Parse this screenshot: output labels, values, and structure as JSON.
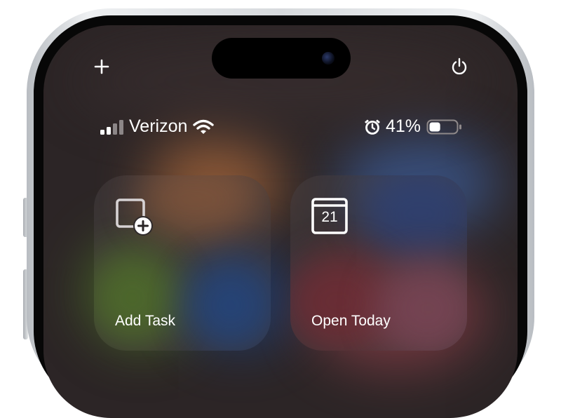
{
  "corner_actions": {
    "add_icon": "plus-icon",
    "power_icon": "power-icon"
  },
  "status_bar": {
    "carrier": "Verizon",
    "signal_icon": "cellular-signal-icon",
    "wifi_icon": "wifi-icon",
    "alarm_icon": "alarm-icon",
    "battery_percent": "41%",
    "battery_level": 0.41
  },
  "controls": [
    {
      "label": "Add Task",
      "icon": "add-task-icon"
    },
    {
      "label": "Open Today",
      "icon": "calendar-icon",
      "icon_text": "21"
    }
  ],
  "colors": {
    "text": "#ffffff",
    "screen_bg": "#2c2526"
  }
}
